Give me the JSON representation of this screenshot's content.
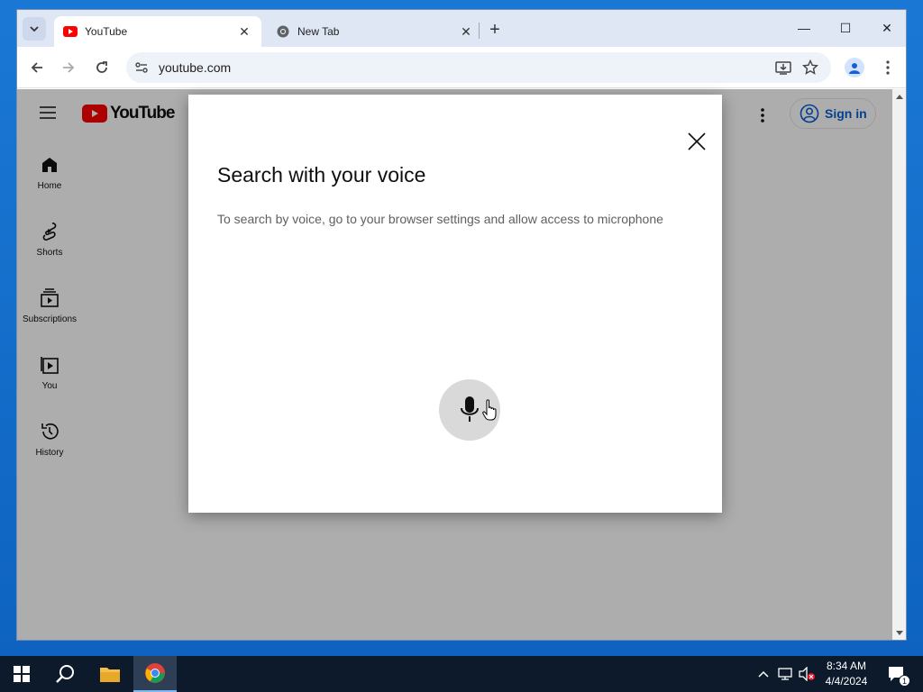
{
  "browser": {
    "tabs": [
      {
        "title": "YouTube",
        "active": true,
        "icon": "youtube-icon"
      },
      {
        "title": "New Tab",
        "active": false,
        "icon": "chrome-icon"
      }
    ],
    "window_controls": {
      "minimize": "—",
      "maximize": "☐",
      "close": "✕"
    },
    "address": "youtube.com"
  },
  "youtube": {
    "logo_text": "YouTube",
    "signin_label": "Sign in",
    "guide": [
      {
        "label": "Home",
        "icon": "home-icon"
      },
      {
        "label": "Shorts",
        "icon": "shorts-icon"
      },
      {
        "label": "Subscriptions",
        "icon": "subscriptions-icon"
      },
      {
        "label": "You",
        "icon": "you-icon"
      },
      {
        "label": "History",
        "icon": "history-icon"
      }
    ]
  },
  "dialog": {
    "title": "Search with your voice",
    "message": "To search by voice, go to your browser settings and allow access to microphone"
  },
  "taskbar": {
    "time": "8:34 AM",
    "date": "4/4/2024",
    "notification_count": "1"
  },
  "colors": {
    "youtube_red": "#ff0000",
    "link_blue": "#065fd4",
    "taskbar": "#0c1a2c"
  }
}
